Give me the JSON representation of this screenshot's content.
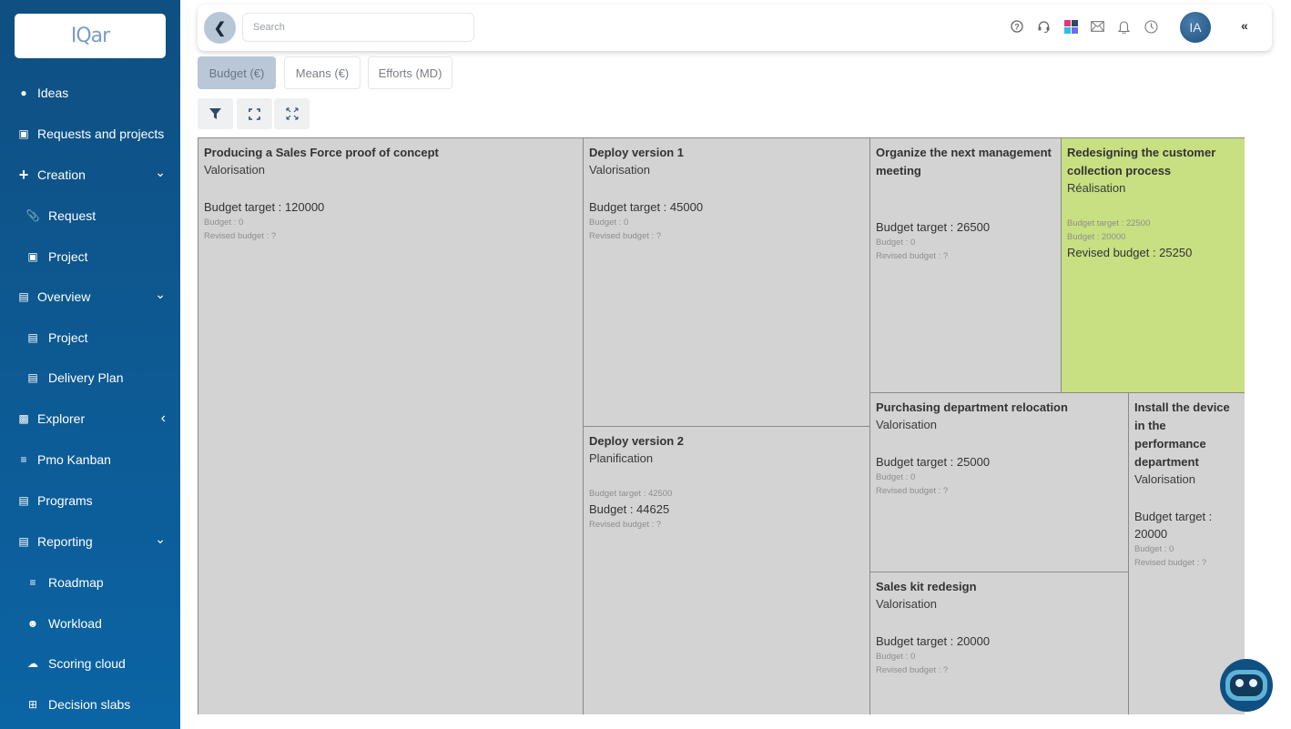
{
  "sidebar": {
    "logo": "IQar",
    "items": [
      {
        "label": "Ideas",
        "icon": "lightbulb-icon",
        "sub": false
      },
      {
        "label": "Requests and projects",
        "icon": "briefcase-icon",
        "sub": false
      },
      {
        "label": "Creation",
        "icon": "plus-icon",
        "sub": false,
        "chevron": "down"
      },
      {
        "label": "Request",
        "icon": "paperclip-plus-icon",
        "sub": true
      },
      {
        "label": "Project",
        "icon": "briefcase-plus-icon",
        "sub": true
      },
      {
        "label": "Overview",
        "icon": "clipboard-icon",
        "sub": false,
        "chevron": "down"
      },
      {
        "label": "Project",
        "icon": "clipboard-icon",
        "sub": true
      },
      {
        "label": "Delivery Plan",
        "icon": "clipboard-icon",
        "sub": true
      },
      {
        "label": "Explorer",
        "icon": "file-download-icon",
        "sub": false,
        "chevron": "left"
      },
      {
        "label": "Pmo Kanban",
        "icon": "checklist-icon",
        "sub": false
      },
      {
        "label": "Programs",
        "icon": "list-alt-icon",
        "sub": false
      },
      {
        "label": "Reporting",
        "icon": "file-text-icon",
        "sub": false,
        "chevron": "down"
      },
      {
        "label": "Roadmap",
        "icon": "bars-icon",
        "sub": true
      },
      {
        "label": "Workload",
        "icon": "users-cog-icon",
        "sub": true
      },
      {
        "label": "Scoring cloud",
        "icon": "cloud-icon",
        "sub": true
      },
      {
        "label": "Decision slabs",
        "icon": "table-icon",
        "sub": true
      }
    ]
  },
  "topbar": {
    "search_placeholder": "Search",
    "avatar_initials": "IA",
    "icons": [
      "help-icon",
      "headset-icon",
      "apps-grid-icon",
      "mail-icon",
      "bell-icon",
      "clock-icon"
    ],
    "collapse_glyph": "«"
  },
  "tabs": [
    {
      "label": "Budget (€)",
      "active": true
    },
    {
      "label": "Means (€)",
      "active": false
    },
    {
      "label": "Efforts (MD)",
      "active": false
    }
  ],
  "tools": [
    "filter-icon",
    "fullscreen-icon",
    "expand-icon"
  ],
  "treemap": {
    "tiles": [
      {
        "title": "Producing a Sales Force proof of concept",
        "phase": "Valorisation",
        "budget_target": "Budget target : 120000",
        "budget": "Budget : 0",
        "revised": "Revised budget : ?",
        "highlight": "target",
        "color": "#d3d3d3"
      },
      {
        "title": "Deploy version 1",
        "phase": "Valorisation",
        "budget_target": "Budget target : 45000",
        "budget": "Budget : 0",
        "revised": "Revised budget : ?",
        "highlight": "target",
        "color": "#d3d3d3"
      },
      {
        "title": "Deploy version 2",
        "phase": "Planification",
        "budget_target": "Budget target : 42500",
        "budget": "Budget : 44625",
        "revised": "Revised budget : ?",
        "highlight": "budget",
        "color": "#d3d3d3"
      },
      {
        "title": "Organize the next management meeting",
        "phase": "",
        "budget_target": "Budget target : 26500",
        "budget": "Budget : 0",
        "revised": "Revised budget : ?",
        "highlight": "target",
        "color": "#d3d3d3"
      },
      {
        "title": "Redesigning the customer collection process",
        "phase": "Réalisation",
        "budget_target": "Budget target : 22500",
        "budget": "Budget : 20000",
        "revised": "Revised budget : 25250",
        "highlight": "revised",
        "color": "#c8df82"
      },
      {
        "title": "Purchasing department relocation",
        "phase": "Valorisation",
        "budget_target": "Budget target : 25000",
        "budget": "Budget : 0",
        "revised": "Revised budget : ?",
        "highlight": "target",
        "color": "#d3d3d3"
      },
      {
        "title": "Sales kit redesign",
        "phase": "Valorisation",
        "budget_target": "Budget target : 20000",
        "budget": "Budget : 0",
        "revised": "Revised budget : ?",
        "highlight": "target",
        "color": "#d3d3d3"
      },
      {
        "title": "Install the device in the performance department",
        "phase": "Valorisation",
        "budget_target": "Budget target : 20000",
        "budget": "Budget : 0",
        "revised": "Revised budget : ?",
        "highlight": "target",
        "color": "#d3d3d3"
      }
    ]
  },
  "chatbot": {
    "icon": "chatbot-icon"
  }
}
